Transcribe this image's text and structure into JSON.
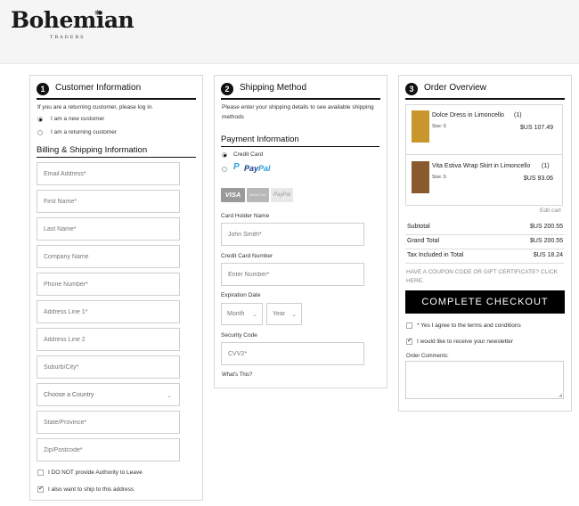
{
  "brand": {
    "name": "Bohemian",
    "sub": "TRADERS"
  },
  "customer": {
    "step": "1",
    "title": "Customer Information",
    "returning_prompt": "If you are a returning customer, please log in.",
    "options": [
      "I am a new customer",
      "I am a returning customer"
    ],
    "selected_option": 0,
    "billing_title": "Billing & Shipping Information",
    "fields": [
      "Email Address*",
      "First Name*",
      "Last Name*",
      "Company Name",
      "Phone Number*",
      "Address Line 1*",
      "Address Line 2",
      "Suburb/City*",
      "Choose a Country",
      "State/Province*",
      "Zip/Postcode*"
    ],
    "checkboxes": [
      {
        "label": "I DO NOT provide Authority to Leave",
        "checked": false
      },
      {
        "label": "I also want to ship to this address",
        "checked": true
      }
    ]
  },
  "shipping": {
    "step": "2",
    "title": "Shipping Method",
    "text": "Please enter your shipping details to see available shipping methods",
    "payment_title": "Payment Information",
    "payment_options": {
      "credit_card": "Credit Card",
      "paypal_1": "Pay",
      "paypal_2": "Pal"
    },
    "selected_payment": "credit_card",
    "card_logos": {
      "visa": "VISA",
      "mastercard": "MasterCard",
      "paypal": "PayPal"
    },
    "card_holder_label": "Card Holder Name",
    "card_holder_placeholder": "John Smith*",
    "card_number_label": "Credit Card Number",
    "card_number_placeholder": "Enter Number*",
    "expiration_label": "Expiration Date",
    "month": "Month",
    "year": "Year",
    "security_label": "Security Code",
    "cvv_placeholder": "CVV2*",
    "whats_this": "What's This?"
  },
  "order": {
    "step": "3",
    "title": "Order Overview",
    "items": [
      {
        "name": "Dolce Dress in Limoncello",
        "qty": "(1)",
        "size": "Size: S",
        "price": "$US 107.49",
        "thumb_color": "#c9962e"
      },
      {
        "name": "Vita Estiva Wrap Skirt in Limoncello",
        "qty": "(1)",
        "size": "Size: S",
        "price": "$US 93.06",
        "thumb_color": "#8a5a2e"
      }
    ],
    "edit_cart": "Edit cart",
    "totals": [
      {
        "label": "Subtotal",
        "value": "$US 200.55"
      },
      {
        "label": "Grand Total",
        "value": "$US 200.55"
      },
      {
        "label": "Tax Included in Total",
        "value": "$US 18.24"
      }
    ],
    "coupon": "HAVE A COUPON CODE OR GIFT CERTIFICATE? CLICK HERE.",
    "checkout": "COMPLETE CHECKOUT",
    "agree_terms": {
      "label": "* Yes I agree to the terms and conditions",
      "checked": false
    },
    "newsletter": {
      "label": "I would like to receive your newsletter",
      "checked": true
    },
    "comments_label": "Order Comments:"
  }
}
